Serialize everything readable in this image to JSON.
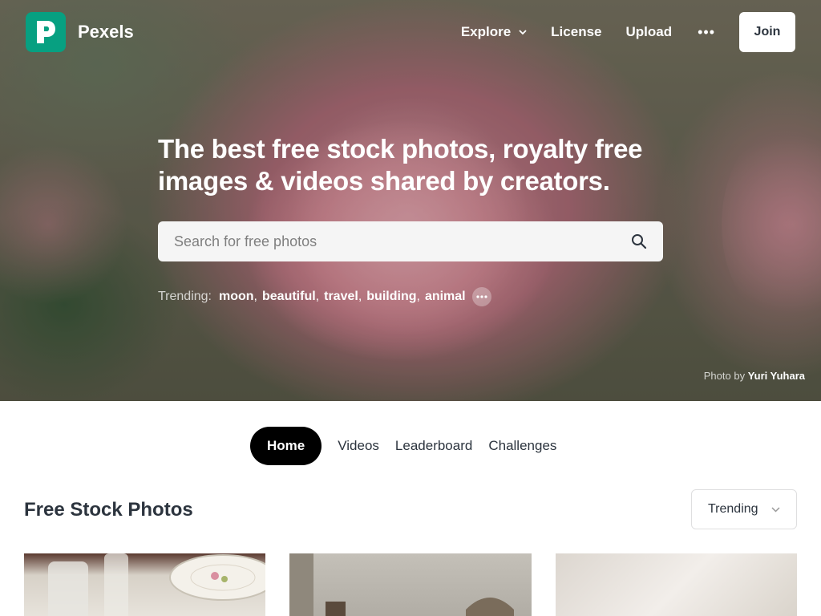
{
  "app": {
    "brand": "Pexels",
    "accent_color": "#07a081"
  },
  "nav": {
    "items": [
      {
        "label": "Explore",
        "has_dropdown": true
      },
      {
        "label": "License"
      },
      {
        "label": "Upload"
      }
    ],
    "more_icon": "ellipsis-icon",
    "join_label": "Join"
  },
  "hero": {
    "headline": "The best free stock photos, royalty free images & videos shared by creators.",
    "search_placeholder": "Search for free photos",
    "trending_label": "Trending:",
    "trending_tags": [
      "moon",
      "beautiful",
      "travel",
      "building",
      "animal"
    ],
    "credit_prefix": "Photo by",
    "credit_author": "Yuri Yuhara"
  },
  "tabs": [
    {
      "label": "Home",
      "active": true
    },
    {
      "label": "Videos"
    },
    {
      "label": "Leaderboard"
    },
    {
      "label": "Challenges"
    }
  ],
  "section": {
    "title": "Free Stock Photos",
    "sort_value": "Trending"
  }
}
